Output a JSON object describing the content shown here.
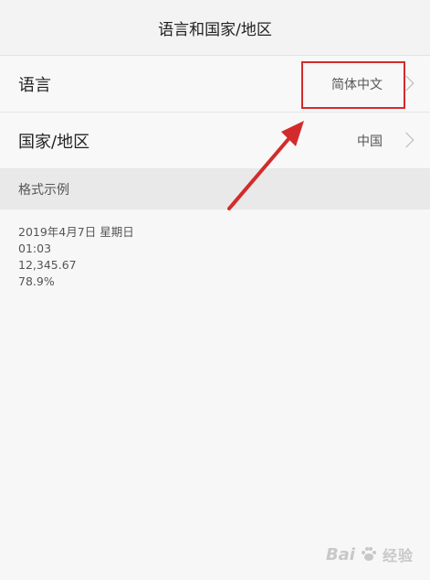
{
  "header": {
    "title": "语言和国家/地区"
  },
  "settings": {
    "language": {
      "label": "语言",
      "value": "简体中文"
    },
    "region": {
      "label": "国家/地区",
      "value": "中国"
    }
  },
  "format_examples": {
    "title": "格式示例",
    "date": "2019年4月7日 星期日",
    "time": "01:03",
    "number": "12,345.67",
    "percent": "78.9%"
  },
  "annotation": {
    "highlight_color": "#d32b2b"
  },
  "watermark": {
    "text_left": "Bai",
    "text_right": "经验",
    "icon": "paw-icon"
  }
}
